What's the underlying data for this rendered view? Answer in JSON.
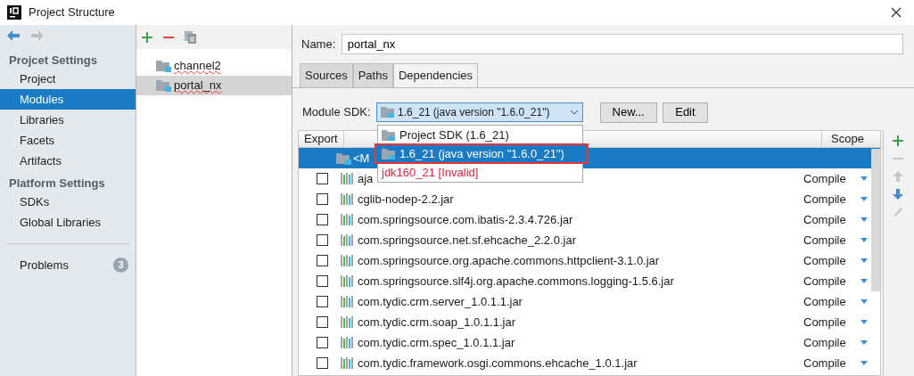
{
  "window": {
    "title": "Project Structure"
  },
  "sidebar": {
    "sections": [
      {
        "title": "Projcet Settings",
        "items": [
          {
            "label": "Project",
            "selected": false
          },
          {
            "label": "Modules",
            "selected": true
          },
          {
            "label": "Libraries",
            "selected": false
          },
          {
            "label": "Facets",
            "selected": false
          },
          {
            "label": "Artifacts",
            "selected": false
          }
        ]
      },
      {
        "title": "Platform Settings",
        "items": [
          {
            "label": "SDKs",
            "selected": false
          },
          {
            "label": "Global Libraries",
            "selected": false
          }
        ]
      }
    ],
    "problems": {
      "label": "Problems",
      "count": "3"
    }
  },
  "modules": [
    {
      "name": "channel2",
      "selected": false
    },
    {
      "name": "portal_nx",
      "selected": true
    }
  ],
  "name_field": {
    "label": "Name:",
    "value": "portal_nx"
  },
  "tabs": [
    {
      "label": "Sources",
      "selected": false
    },
    {
      "label": "Paths",
      "selected": false
    },
    {
      "label": "Dependencies",
      "selected": true
    }
  ],
  "module_sdk": {
    "label": "Module SDK:",
    "name": "1.6_21",
    "detail": "(java version \"1.6.0_21\")",
    "buttons": [
      "New...",
      "Edit"
    ],
    "options": [
      {
        "name": "Project SDK",
        "detail": "(1.6_21)",
        "selected": false,
        "invalid": false,
        "highlighted": false
      },
      {
        "name": "1.6_21",
        "detail": "(java version \"1.6.0_21\")",
        "selected": true,
        "invalid": false,
        "highlighted": true
      },
      {
        "name": "jdk160_21",
        "detail": "[Invalid]",
        "selected": false,
        "invalid": true,
        "highlighted": false
      }
    ]
  },
  "table": {
    "columns": [
      "Export",
      "Scope"
    ],
    "rows": [
      {
        "kind": "source",
        "name": "<M",
        "selected": true
      },
      {
        "kind": "library",
        "name": "aja",
        "checked": false,
        "scope": "Compile",
        "selected": false
      },
      {
        "kind": "library",
        "name": "cglib-nodep-2.2.jar",
        "checked": false,
        "scope": "Compile",
        "selected": false
      },
      {
        "kind": "library",
        "name": "com.springsource.com.ibatis-2.3.4.726.jar",
        "checked": false,
        "scope": "Compile",
        "selected": false
      },
      {
        "kind": "library",
        "name": "com.springsource.net.sf.ehcache_2.2.0.jar",
        "checked": false,
        "scope": "Compile",
        "selected": false
      },
      {
        "kind": "library",
        "name": "com.springsource.org.apache.commons.httpclient-3.1.0.jar",
        "checked": false,
        "scope": "Compile",
        "selected": false
      },
      {
        "kind": "library",
        "name": "com.springsource.slf4j.org.apache.commons.logging-1.5.6.jar",
        "checked": false,
        "scope": "Compile",
        "selected": false
      },
      {
        "kind": "library",
        "name": "com.tydic.crm.server_1.0.1.1.jar",
        "checked": false,
        "scope": "Compile",
        "selected": false
      },
      {
        "kind": "library",
        "name": "com.tydic.crm.soap_1.0.1.1.jar",
        "checked": false,
        "scope": "Compile",
        "selected": false
      },
      {
        "kind": "library",
        "name": "com.tydic.crm.spec_1.0.1.1.jar",
        "checked": false,
        "scope": "Compile",
        "selected": false
      },
      {
        "kind": "library",
        "name": "com.tydic.framework.osgi.commons.ehcache_1.0.1.jar",
        "checked": false,
        "scope": "Compile",
        "selected": false
      }
    ]
  }
}
